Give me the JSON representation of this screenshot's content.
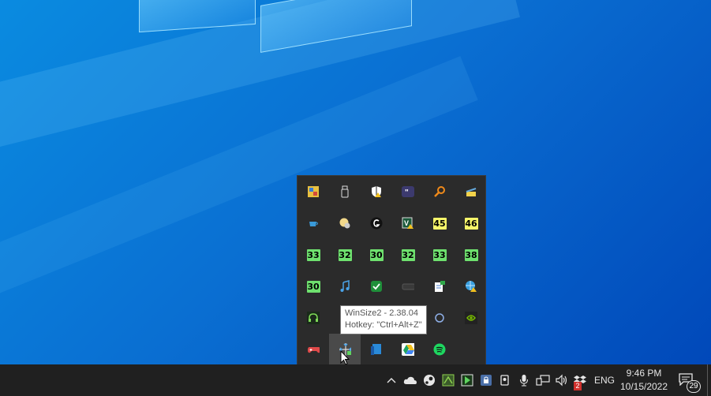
{
  "tray_overflow": {
    "rows": [
      [
        {
          "icon": "colorful-app-icon"
        },
        {
          "icon": "usb-drive-icon"
        },
        {
          "icon": "shield-warning-icon"
        },
        {
          "icon": "quote-app-icon"
        },
        {
          "icon": "search-magnifier-icon"
        },
        {
          "icon": "cake-icon"
        }
      ],
      [
        {
          "icon": "coffee-cup-icon"
        },
        {
          "icon": "lightbulb-pie-icon"
        },
        {
          "icon": "logitech-g-icon"
        },
        {
          "icon": "veeam-warning-icon"
        },
        {
          "text": "45",
          "color": "#f5f56a"
        },
        {
          "text": "46",
          "color": "#f5f56a"
        }
      ],
      [
        {
          "text": "33",
          "color": "#6ee06e"
        },
        {
          "text": "32",
          "color": "#6ee06e"
        },
        {
          "text": "30",
          "color": "#6ee06e"
        },
        {
          "text": "32",
          "color": "#6ee06e"
        },
        {
          "text": "33",
          "color": "#6ee06e"
        },
        {
          "text": "38",
          "color": "#6ee06e"
        }
      ],
      [
        {
          "text": "30",
          "color": "#6ee06e"
        },
        {
          "icon": "music-note-icon"
        },
        {
          "icon": "green-check-icon"
        },
        {
          "icon": "keyboard-icon"
        },
        {
          "icon": "document-sync-icon"
        },
        {
          "icon": "globe-warning-icon"
        }
      ],
      [
        {
          "icon": "headset-icon"
        },
        {
          "icon": "blue-app-icon"
        },
        {
          "icon": "hidden-icon"
        },
        {
          "icon": "hidden-icon"
        },
        {
          "icon": "circle-app-icon"
        },
        {
          "icon": "nvidia-icon"
        }
      ],
      [
        {
          "icon": "gamepad-icon"
        },
        {
          "icon": "winsize-icon",
          "hover": true
        },
        {
          "icon": "blue-panel-icon"
        },
        {
          "icon": "google-drive-icon"
        },
        {
          "icon": "spotify-icon"
        }
      ]
    ]
  },
  "tooltip": {
    "line1": "WinSize2 - 2.38.04",
    "line2": "Hotkey: \"Ctrl+Alt+Z\""
  },
  "taskbar": {
    "tray_icons": [
      "chevron-up-icon",
      "onedrive-icon",
      "steam-icon",
      "app-green-icon",
      "app-play-icon",
      "lock-app-icon",
      "camera-icon",
      "microphone-icon",
      "network-icon",
      "volume-icon",
      "dropbox-icon"
    ],
    "dropbox_badge": "2",
    "language": "ENG",
    "time": "9:46 PM",
    "date": "10/15/2022",
    "notification_count": "29"
  }
}
